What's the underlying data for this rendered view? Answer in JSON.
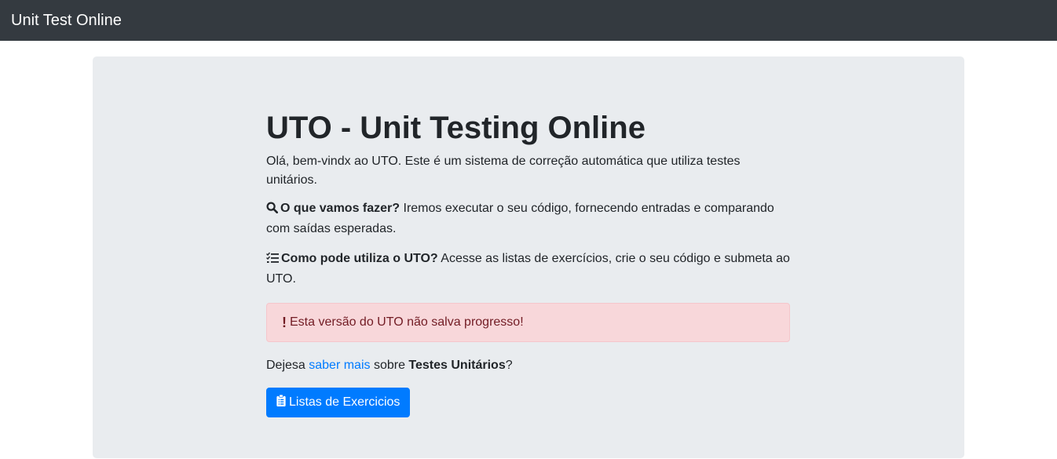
{
  "navbar": {
    "brand": "Unit Test Online"
  },
  "jumbotron": {
    "title": "UTO - Unit Testing Online",
    "intro": "Olá, bem-vindx ao UTO. Este é um sistema de correção automática que utiliza testes unitários.",
    "what": {
      "icon": "search-icon",
      "question": "O que vamos fazer?",
      "answer": " Iremos executar o seu código, fornecendo entradas e comparando com saídas esperadas."
    },
    "how": {
      "icon": "list-check-icon",
      "question": "Como pode utiliza o UTO?",
      "answer": " Acesse as listas de exercícios, crie o seu código e submeta ao UTO."
    },
    "alert": {
      "icon": "exclamation-icon",
      "text": "Esta versão do UTO não salva progresso!"
    },
    "learn_more": {
      "prefix": "Dejesa ",
      "link": "saber mais",
      "middle": " sobre ",
      "bold": "Testes Unitários",
      "suffix": "?"
    },
    "button": {
      "icon": "clipboard-icon",
      "label": "Listas de Exercicios"
    }
  },
  "colors": {
    "navbar_bg": "#343a40",
    "jumbotron_bg": "#e9ecef",
    "alert_bg": "#f8d7da",
    "alert_text": "#721c24",
    "primary": "#007bff"
  }
}
